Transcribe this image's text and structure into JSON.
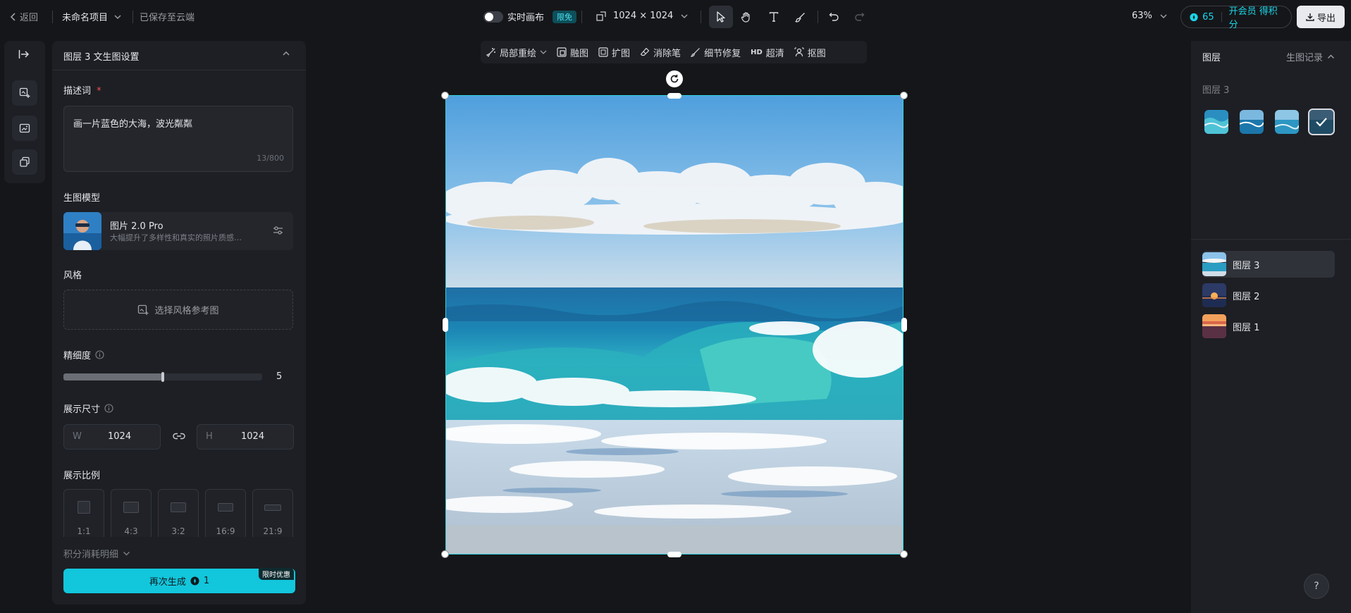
{
  "topbar": {
    "back_label": "返回",
    "project_name": "未命名项目",
    "save_status": "已保存至云端",
    "realtime_label": "实时画布",
    "realtime_badge": "限免",
    "canvas_size": "1024 × 1024",
    "zoom": "63%",
    "credits": "65",
    "member_label": "开会员 得积分",
    "export_label": "导出"
  },
  "settings": {
    "title": "图层 3 文生图设置",
    "prompt_label": "描述词",
    "prompt_required": "*",
    "prompt_text": "画一片蓝色的大海，波光粼粼",
    "prompt_count": "13/800",
    "model_label": "生图模型",
    "model_name": "图片 2.0 Pro",
    "model_desc": "大幅提升了多样性和真实的照片质感…",
    "style_label": "风格",
    "style_button": "选择风格参考图",
    "detail_label": "精细度",
    "detail_value": "5",
    "detail_level_fraction": 0.5,
    "size_label": "展示尺寸",
    "width_prefix": "W",
    "width_value": "1024",
    "height_prefix": "H",
    "height_value": "1024",
    "ratio_label": "展示比例",
    "ratios": [
      "1:1",
      "4:3",
      "3:2",
      "16:9",
      "21:9"
    ],
    "cost_label": "积分消耗明细",
    "generate_label": "再次生成",
    "generate_cost": "1",
    "promo_badge": "限时优惠"
  },
  "minitools": {
    "items": [
      "局部重绘",
      "融图",
      "扩图",
      "消除笔",
      "细节修复",
      "超清",
      "抠图"
    ],
    "hd_prefix": "HD"
  },
  "layers_panel": {
    "title": "图层",
    "history_label": "生图记录",
    "current_layer": "图层 3",
    "layers": [
      "图层 3",
      "图层 2",
      "图层 1"
    ]
  },
  "help_label": "?",
  "colors": {
    "accent": "#1bd5e8",
    "generate_button": "#12c6dc",
    "required": "#f04e4e",
    "background": "#151619",
    "panel": "#1d1f24"
  }
}
